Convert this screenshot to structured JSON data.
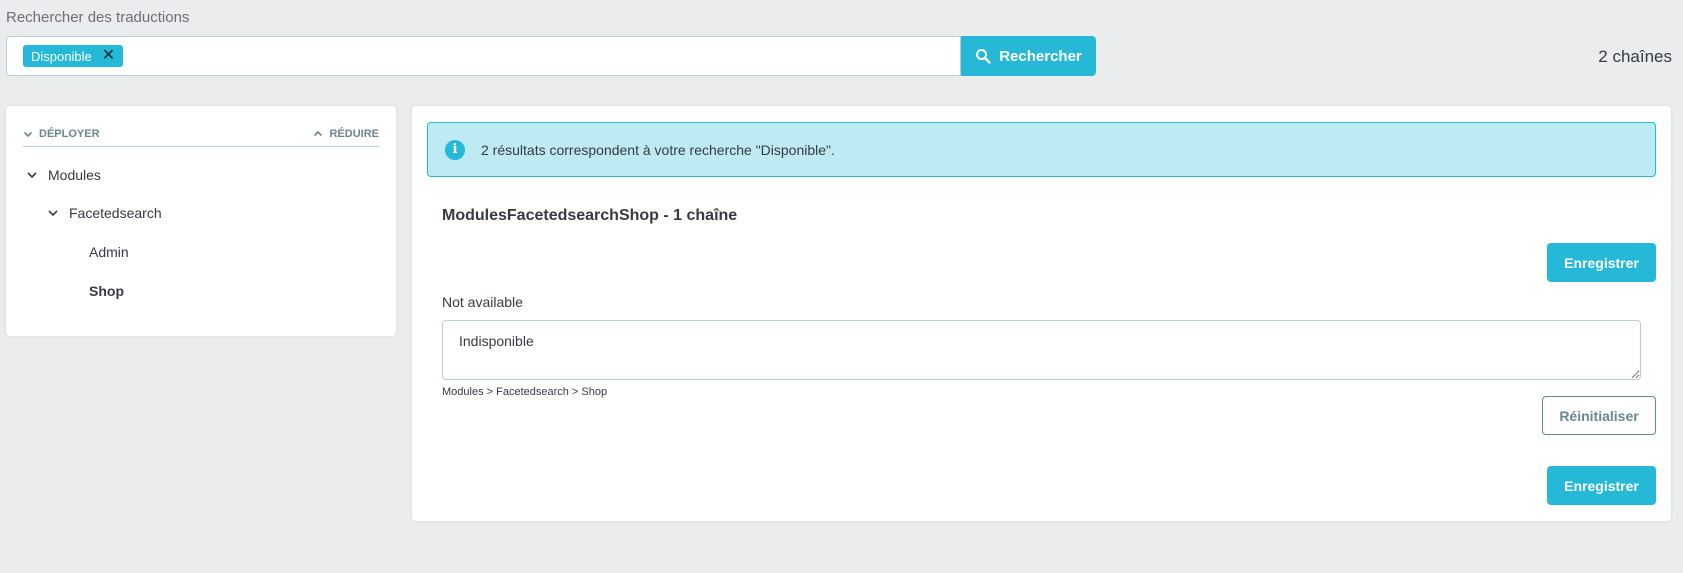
{
  "search": {
    "label": "Rechercher des traductions",
    "tag": "Disponible",
    "button_label": "Rechercher",
    "result_count": "2 chaînes"
  },
  "tree": {
    "expand_label": "DÉPLOYER",
    "collapse_label": "RÉDUIRE",
    "items": [
      {
        "label": "Modules"
      },
      {
        "label": "Facetedsearch"
      },
      {
        "label": "Admin"
      },
      {
        "label": "Shop"
      }
    ]
  },
  "main": {
    "alert_text": "2 résultats correspondent à votre recherche \"Disponible\".",
    "domain_title": "ModulesFacetedsearchShop - 1 chaîne",
    "save_label": "Enregistrer",
    "source_text": "Not available",
    "translation_value": "Indisponible",
    "breadcrumb": "Modules > Facetedsearch > Shop",
    "reset_label": "Réinitialiser"
  },
  "colors": {
    "accent": "#25b9d7",
    "background": "#ebecee",
    "alert_bg": "#beeaf3",
    "text": "#363a41"
  }
}
